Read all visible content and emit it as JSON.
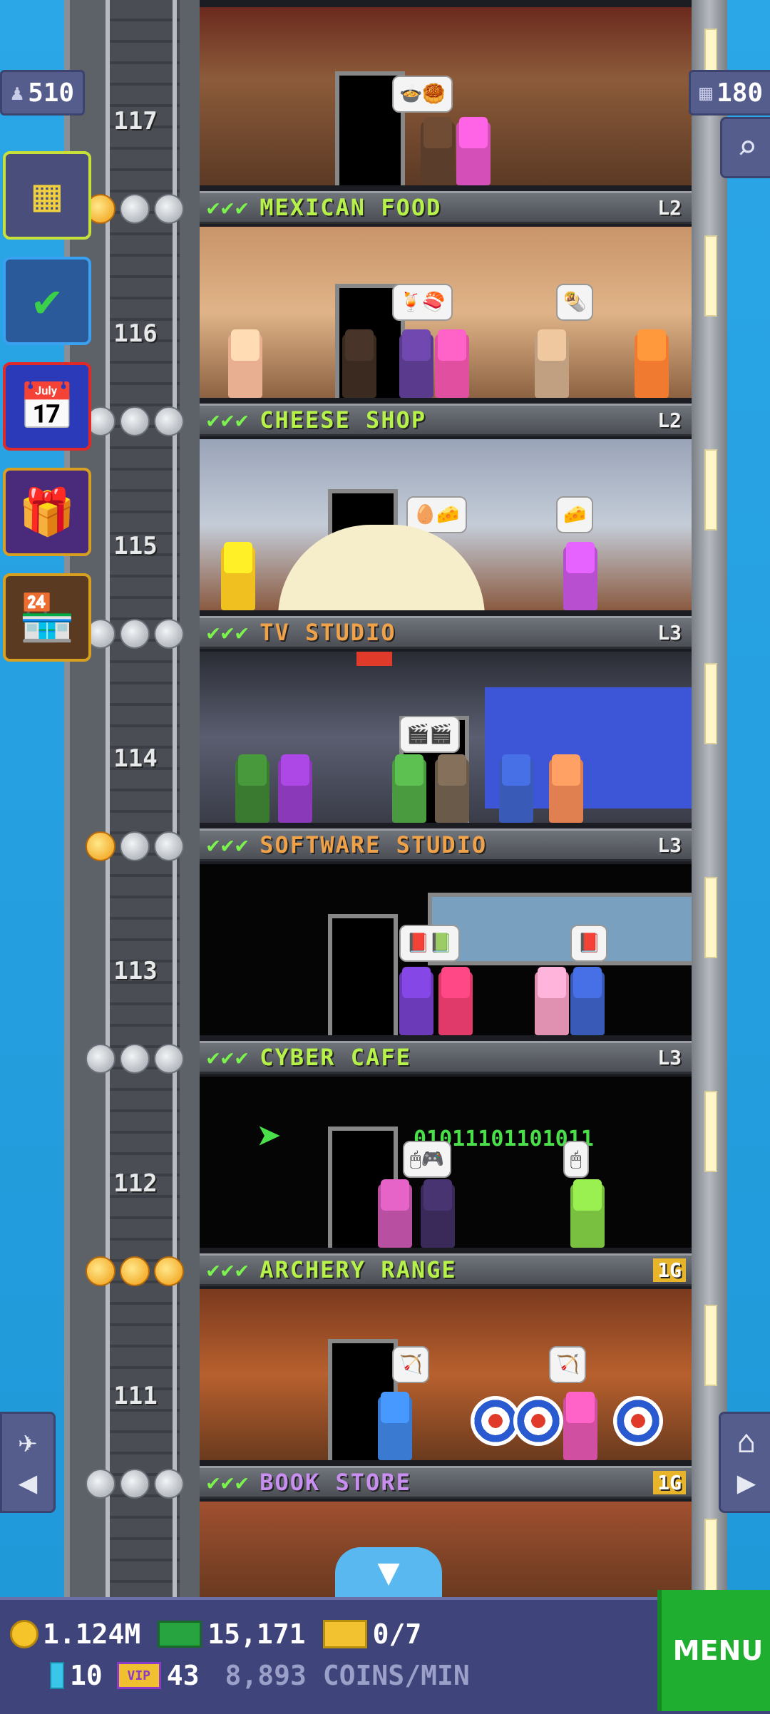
{
  "header": {
    "population": "510",
    "floors_count": "180"
  },
  "floors": [
    {
      "number": "117",
      "name": "MEXICAN FOOD",
      "level": "L2",
      "name_color": "#b6f24a",
      "level_style": "plain"
    },
    {
      "number": "116",
      "name": "CHEESE SHOP",
      "level": "L2",
      "name_color": "#b6f24a",
      "level_style": "plain"
    },
    {
      "number": "115",
      "name": "TV STUDIO",
      "level": "L3",
      "name_color": "#f0a24a",
      "level_style": "plain"
    },
    {
      "number": "114",
      "name": "SOFTWARE STUDIO",
      "level": "L3",
      "name_color": "#f0a24a",
      "level_style": "plain"
    },
    {
      "number": "113",
      "name": "CYBER CAFE",
      "level": "L3",
      "name_color": "#b6f24a",
      "level_style": "plain"
    },
    {
      "number": "112",
      "name": "ARCHERY RANGE",
      "level": "1G",
      "name_color": "#b6f24a",
      "level_style": "gold"
    },
    {
      "number": "111",
      "name": "BOOK STORE",
      "level": "1G",
      "name_color": "#c98ff0",
      "level_style": "gold"
    }
  ],
  "room_text": {
    "binary": "01011101101011"
  },
  "hud": {
    "coins": "1.124M",
    "bux": "15,171",
    "tickets": "0/7",
    "gems": "10",
    "vip": "43",
    "rate": "8,893 COINS/MIN",
    "menu_label": "MENU"
  },
  "icons": [
    "person-icon",
    "building-icon",
    "tasks-icon",
    "calendar-icon",
    "gift-icon",
    "market-icon",
    "search-icon",
    "plane-icon",
    "home-icon",
    "chevron-down-icon"
  ]
}
